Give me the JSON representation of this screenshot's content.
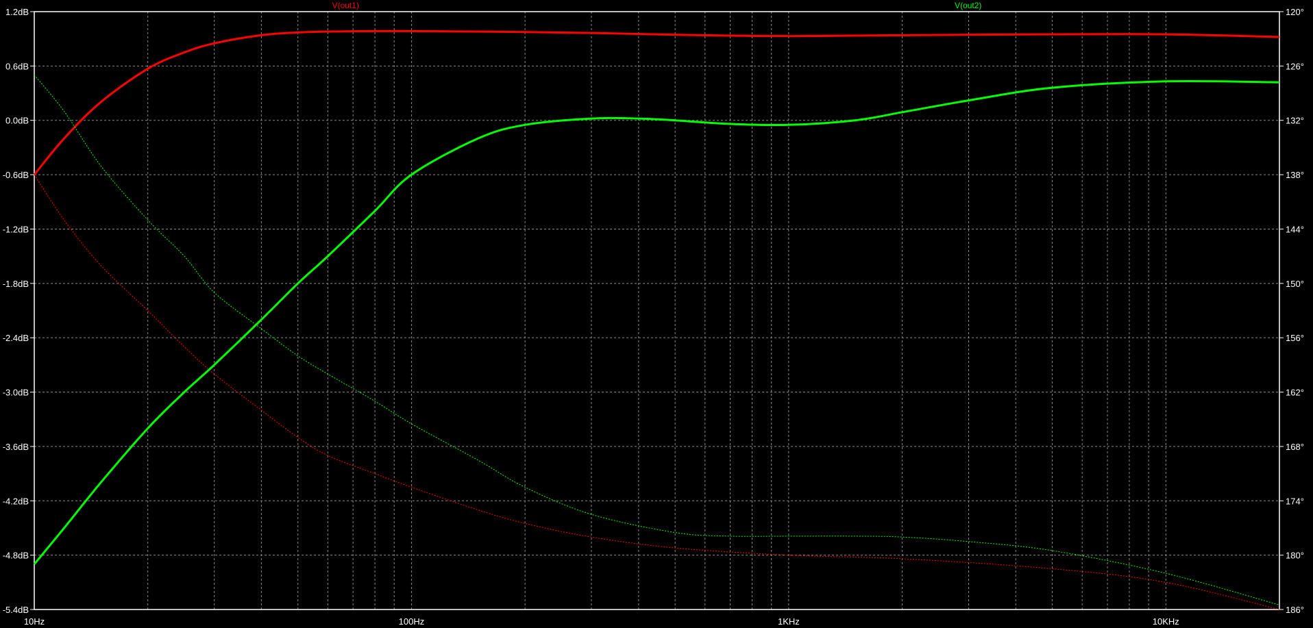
{
  "chart_data": {
    "type": "line",
    "x_scale": "log",
    "xlim": [
      10,
      20000
    ],
    "x_ticks": [
      10,
      100,
      1000,
      10000
    ],
    "x_tick_labels": [
      "10Hz",
      "100Hz",
      "1KHz",
      "10KHz"
    ],
    "ylim_left": [
      -5.4,
      1.2
    ],
    "y_ticks_left": [
      1.2,
      0.6,
      0.0,
      -0.6,
      -1.2,
      -1.8,
      -2.4,
      -3.0,
      -3.6,
      -4.2,
      -4.8,
      -5.4
    ],
    "y_tick_labels_left": [
      "1.2dB",
      "0.6dB",
      "0.0dB",
      "-0.6dB",
      "-1.2dB",
      "-1.8dB",
      "-2.4dB",
      "-3.0dB",
      "-3.6dB",
      "-4.2dB",
      "-4.8dB",
      "-5.4dB"
    ],
    "ylim_right": [
      -186,
      -120
    ],
    "y_ticks_right": [
      -120,
      -126,
      -132,
      -138,
      -144,
      -150,
      -156,
      -162,
      -168,
      -174,
      -180,
      -186
    ],
    "y_tick_labels_right": [
      "120°",
      "126°",
      "132°",
      "138°",
      "144°",
      "150°",
      "156°",
      "162°",
      "168°",
      "174°",
      "180°",
      "186°"
    ],
    "grid": true,
    "background": "#000000",
    "series": [
      {
        "name": "V(out1)",
        "color": "#ff0000",
        "quantity": "magnitude",
        "axis": "left",
        "x": [
          10,
          12,
          15,
          20,
          25,
          30,
          40,
          50,
          60,
          80,
          100,
          150,
          200,
          300,
          500,
          1000,
          2000,
          5000,
          10000,
          20000
        ],
        "y": [
          -0.6,
          -0.2,
          0.2,
          0.57,
          0.75,
          0.85,
          0.94,
          0.97,
          0.98,
          0.985,
          0.985,
          0.98,
          0.975,
          0.965,
          0.945,
          0.93,
          0.94,
          0.95,
          0.95,
          0.92
        ]
      },
      {
        "name": "V(out1)",
        "color": "#ff0000",
        "quantity": "phase",
        "axis": "right",
        "x": [
          10,
          12,
          15,
          20,
          25,
          30,
          40,
          50,
          60,
          80,
          100,
          150,
          200,
          300,
          500,
          1000,
          2000,
          5000,
          10000,
          20000
        ],
        "y": [
          -138,
          -143,
          -148,
          -153,
          -157,
          -160,
          -164,
          -167,
          -169,
          -171,
          -172.5,
          -175,
          -176.5,
          -178,
          -179.2,
          -180,
          -180.4,
          -181.5,
          -183,
          -186
        ]
      },
      {
        "name": "V(out2)",
        "color": "#00ff00",
        "quantity": "magnitude",
        "axis": "left",
        "x": [
          10,
          12,
          15,
          20,
          25,
          30,
          40,
          50,
          60,
          80,
          100,
          150,
          200,
          300,
          400,
          500,
          700,
          1000,
          1500,
          2000,
          3000,
          5000,
          10000,
          20000
        ],
        "y": [
          -4.9,
          -4.5,
          -4.0,
          -3.4,
          -3.0,
          -2.7,
          -2.2,
          -1.8,
          -1.5,
          -1.0,
          -0.6,
          -0.2,
          -0.05,
          0.02,
          0.02,
          0.0,
          -0.04,
          -0.05,
          0.0,
          0.09,
          0.22,
          0.36,
          0.43,
          0.42
        ]
      },
      {
        "name": "V(out2)",
        "color": "#00ff00",
        "quantity": "phase",
        "axis": "right",
        "x": [
          10,
          12,
          15,
          20,
          25,
          30,
          40,
          50,
          60,
          80,
          100,
          150,
          200,
          300,
          500,
          700,
          1000,
          1500,
          2000,
          3000,
          5000,
          10000,
          20000
        ],
        "y": [
          -127,
          -131,
          -137,
          -143,
          -147,
          -151,
          -155,
          -158,
          -160,
          -163,
          -165.5,
          -169.5,
          -172.5,
          -175.5,
          -177.5,
          -177.9,
          -177.9,
          -177.9,
          -178,
          -178.5,
          -179.5,
          -182,
          -185.5
        ]
      }
    ]
  }
}
